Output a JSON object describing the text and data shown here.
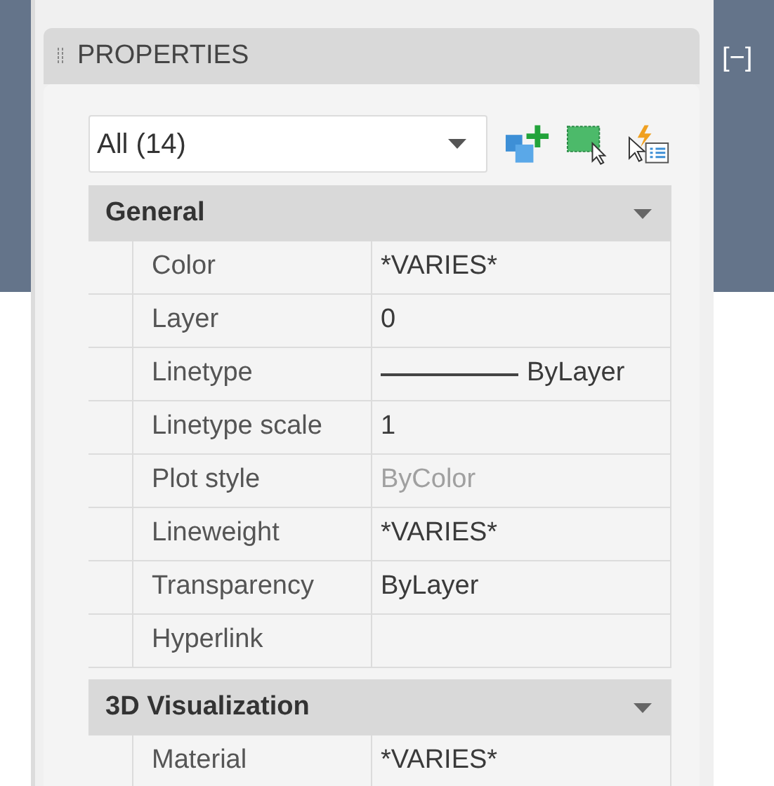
{
  "panel": {
    "title": "PROPERTIES",
    "corner_label": "[−]"
  },
  "selection": {
    "value": "All (14)"
  },
  "sections": [
    {
      "title": "General",
      "expanded": true,
      "rows": [
        {
          "name": "Color",
          "value": "*VARIES*",
          "kind": "text",
          "disabled": false
        },
        {
          "name": "Layer",
          "value": "0",
          "kind": "text",
          "disabled": false
        },
        {
          "name": "Linetype",
          "value": "ByLayer",
          "kind": "linetype",
          "disabled": false
        },
        {
          "name": "Linetype scale",
          "value": "1",
          "kind": "text",
          "disabled": false
        },
        {
          "name": "Plot style",
          "value": "ByColor",
          "kind": "text",
          "disabled": true
        },
        {
          "name": "Lineweight",
          "value": "*VARIES*",
          "kind": "text",
          "disabled": false
        },
        {
          "name": "Transparency",
          "value": "ByLayer",
          "kind": "text",
          "disabled": false
        },
        {
          "name": "Hyperlink",
          "kind": "text",
          "disabled": false
        }
      ]
    },
    {
      "title": "3D Visualization",
      "expanded": true,
      "rows": [
        {
          "name": "Material",
          "value": "*VARIES*",
          "kind": "text",
          "disabled": false
        }
      ]
    }
  ]
}
